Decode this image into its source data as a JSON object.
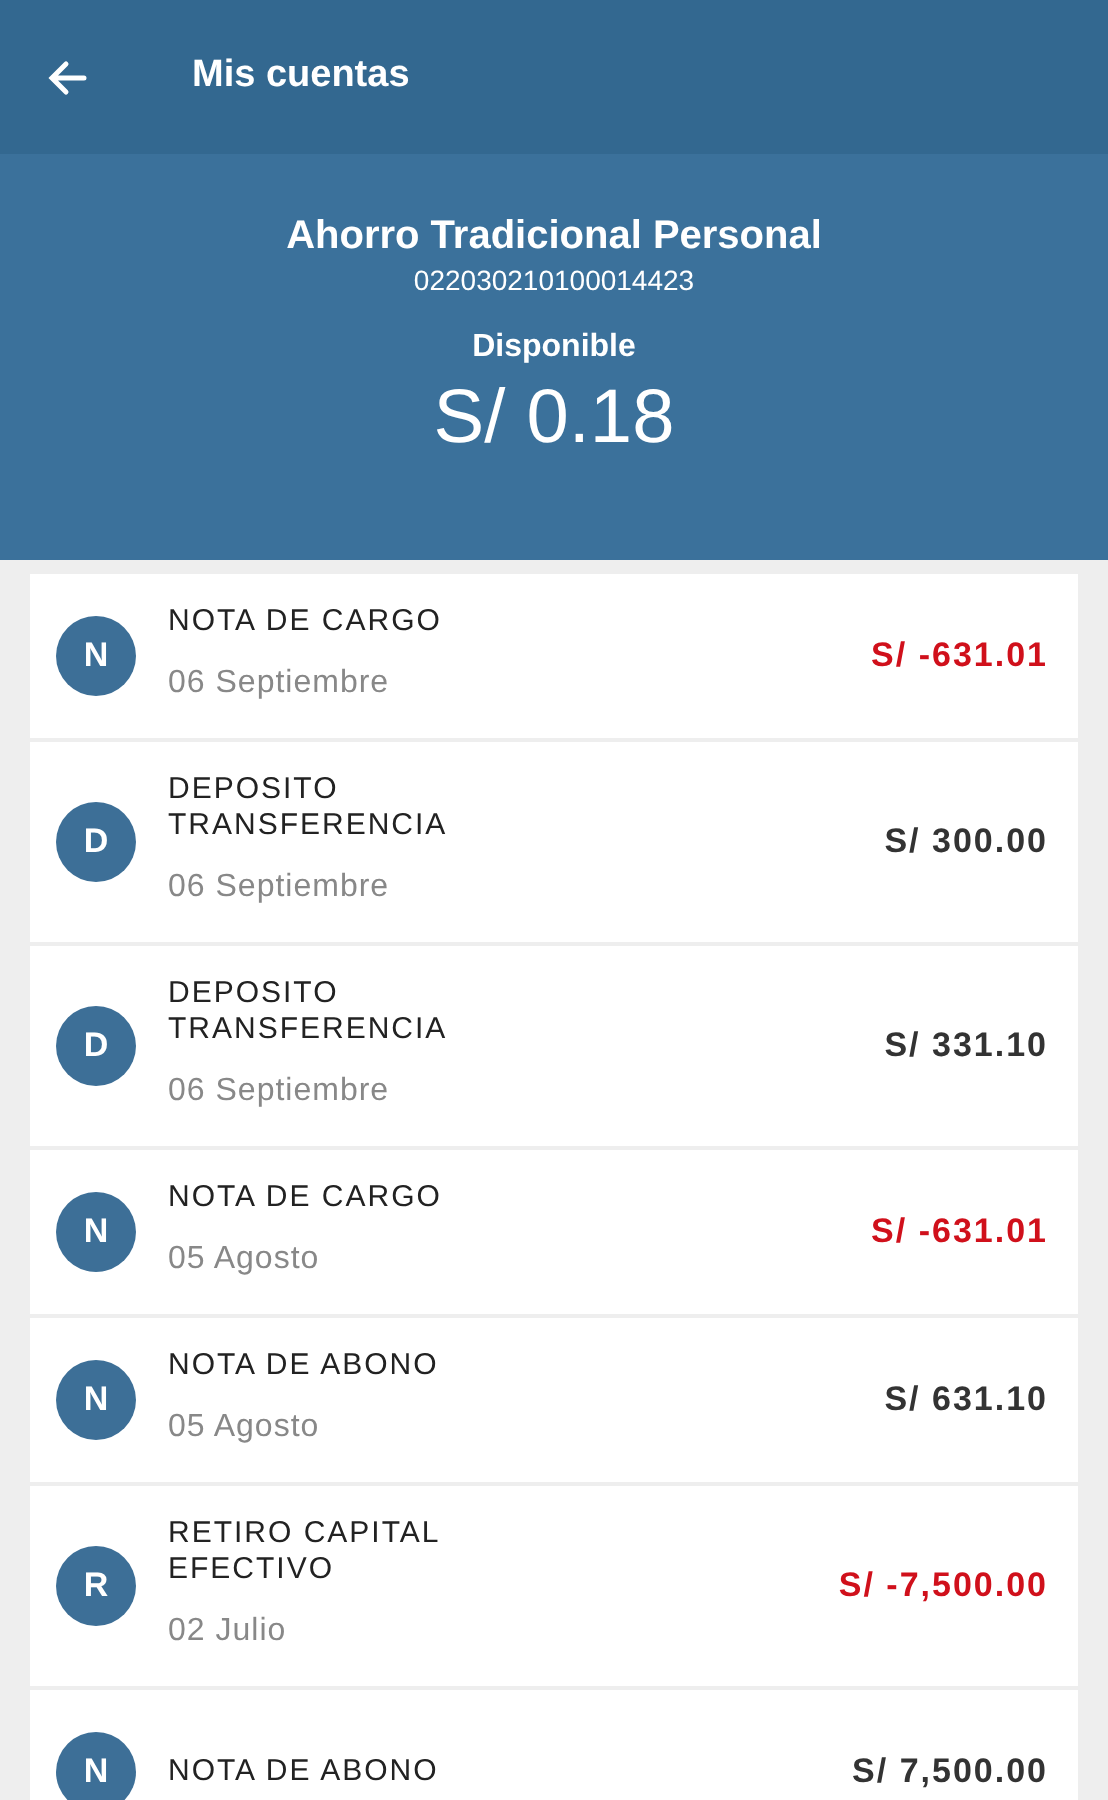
{
  "app_bar": {
    "title": "Mis cuentas"
  },
  "account": {
    "name": "Ahorro Tradicional Personal",
    "number": "022030210100014423",
    "balance_label": "Disponible",
    "balance": "S/ 0.18"
  },
  "transactions": [
    {
      "initial": "N",
      "title": [
        "NOTA DE CARGO"
      ],
      "date": "06 Septiembre",
      "amount": "S/ -631.01",
      "kind": "debit"
    },
    {
      "initial": "D",
      "title": [
        "DEPOSITO",
        "TRANSFERENCIA"
      ],
      "date": "06 Septiembre",
      "amount": "S/ 300.00",
      "kind": "credit"
    },
    {
      "initial": "D",
      "title": [
        "DEPOSITO",
        "TRANSFERENCIA"
      ],
      "date": "06 Septiembre",
      "amount": "S/ 331.10",
      "kind": "credit"
    },
    {
      "initial": "N",
      "title": [
        "NOTA DE CARGO"
      ],
      "date": "05 Agosto",
      "amount": "S/ -631.01",
      "kind": "debit"
    },
    {
      "initial": "N",
      "title": [
        "NOTA DE ABONO"
      ],
      "date": "05 Agosto",
      "amount": "S/ 631.10",
      "kind": "credit"
    },
    {
      "initial": "R",
      "title": [
        "RETIRO CAPITAL",
        "EFECTIVO"
      ],
      "date": "02 Julio",
      "amount": "S/ -7,500.00",
      "kind": "debit"
    },
    {
      "initial": "N",
      "title": [
        "NOTA DE ABONO"
      ],
      "amount": "S/ 7,500.00",
      "kind": "credit"
    }
  ]
}
